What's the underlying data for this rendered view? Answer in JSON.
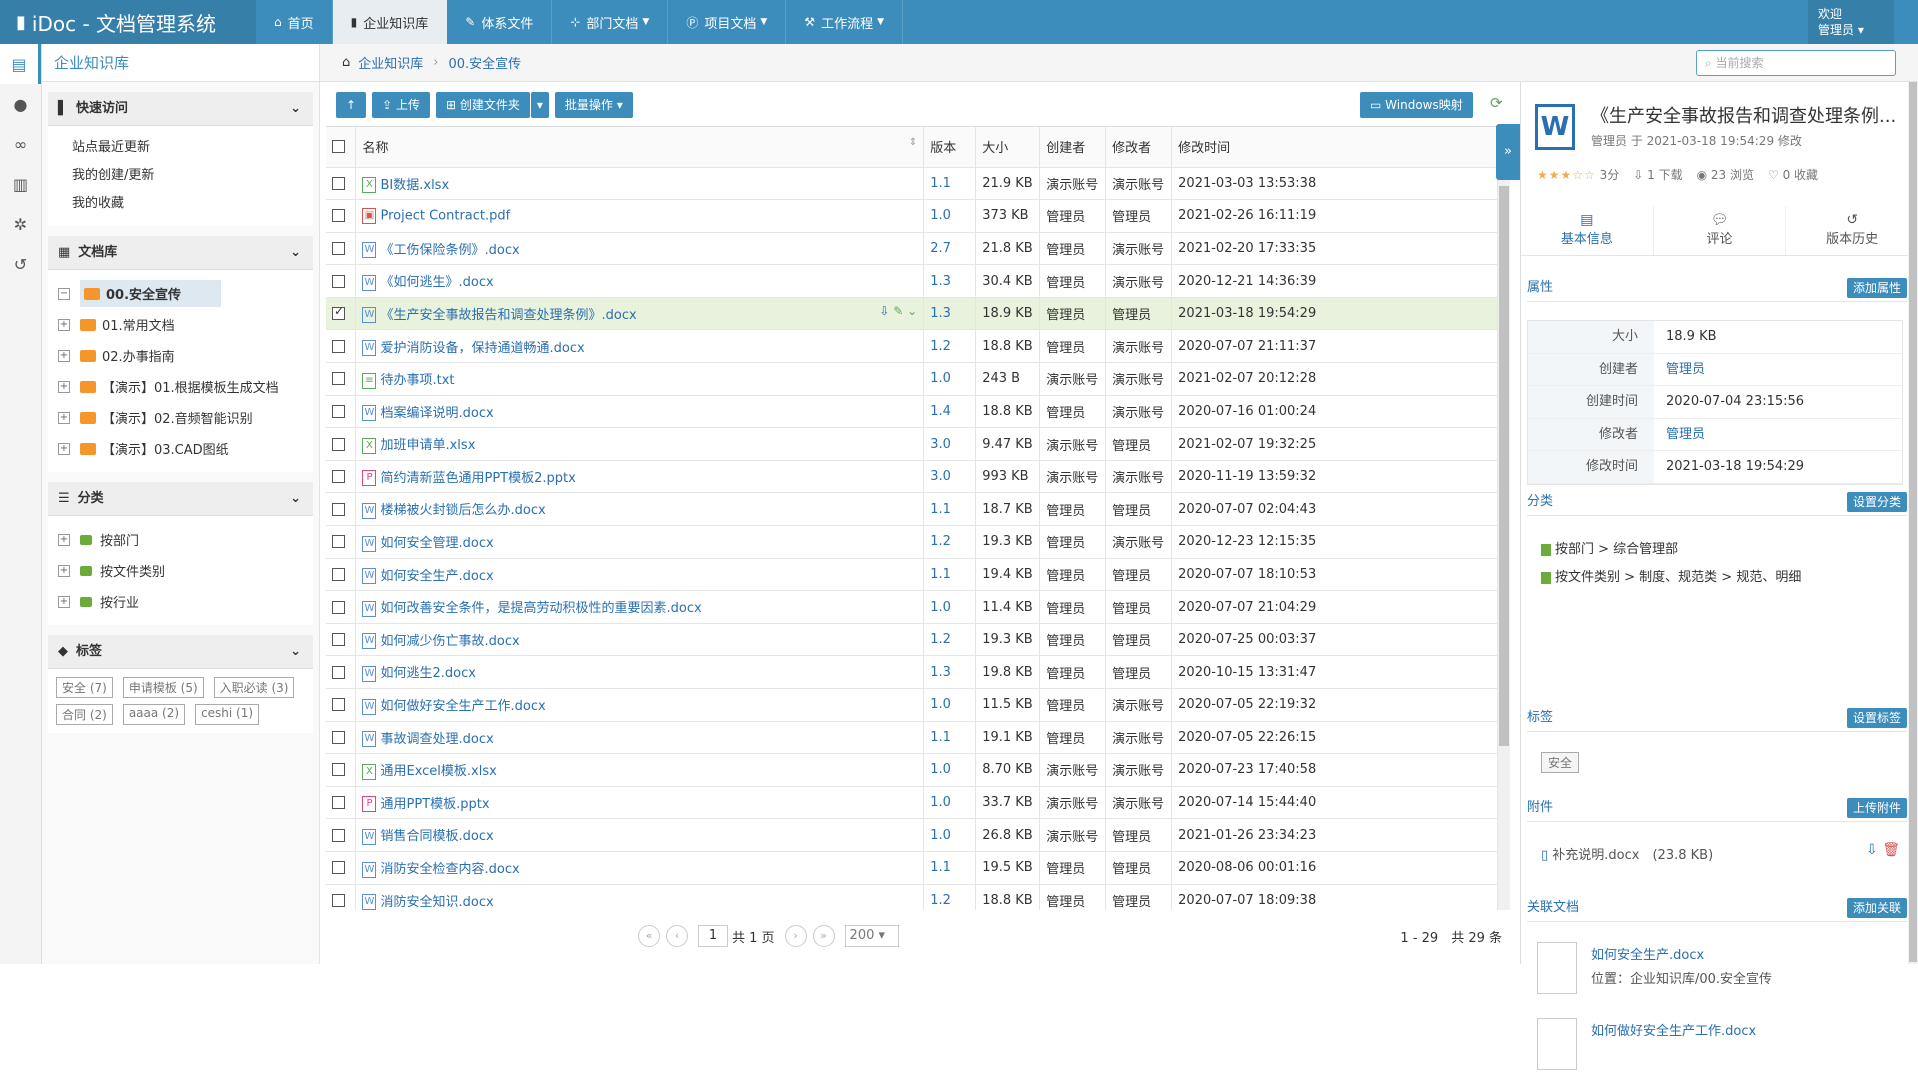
{
  "app": {
    "brand": "iDoc - 文档管理系统"
  },
  "nav": [
    {
      "icon": "home-icon",
      "label": "首页",
      "caret": false,
      "active": false
    },
    {
      "icon": "book-icon",
      "label": "企业知识库",
      "caret": false,
      "active": true
    },
    {
      "icon": "pencil-icon",
      "label": "体系文件",
      "caret": false,
      "active": false
    },
    {
      "icon": "org-icon",
      "label": "部门文档",
      "caret": true,
      "active": false
    },
    {
      "icon": "project-icon",
      "label": "项目文档",
      "caret": true,
      "active": false
    },
    {
      "icon": "workflow-icon",
      "label": "工作流程",
      "caret": true,
      "active": false
    }
  ],
  "user": {
    "welcome": "欢迎",
    "name": "管理员"
  },
  "sidebar": {
    "title": "企业知识库",
    "quick_access": {
      "heading": "快速访问",
      "items": [
        "站点最近更新",
        "我的创建/更新",
        "我的收藏"
      ]
    },
    "library": {
      "heading": "文档库",
      "selected": "00.安全宣传",
      "items": [
        "01.常用文档",
        "02.办事指南",
        "【演示】01.根据模板生成文档",
        "【演示】02.音频智能识别",
        "【演示】03.CAD图纸"
      ]
    },
    "categories": {
      "heading": "分类",
      "items": [
        "按部门",
        "按文件类别",
        "按行业"
      ]
    },
    "tags": {
      "heading": "标签",
      "items": [
        "安全 (7)",
        "申请模板 (5)",
        "入职必读 (3)",
        "合同 (2)",
        "aaaa (2)",
        "ceshi (1)"
      ]
    }
  },
  "breadcrumb": {
    "root": "企业知识库",
    "current": "00.安全宣传"
  },
  "search": {
    "placeholder": "当前搜索"
  },
  "toolbar": {
    "up_label": "↑",
    "upload_label": "上传",
    "create_folder_label": "创建文件夹",
    "batch_label": "批量操作",
    "windows_map_label": "Windows映射"
  },
  "table": {
    "headers": [
      "名称",
      "版本",
      "大小",
      "创建者",
      "修改者",
      "修改时间"
    ],
    "rows": [
      {
        "type": "x",
        "name": "BI数据.xlsx",
        "ver": "1.1",
        "size": "21.9 KB",
        "creator": "演示账号",
        "modifier": "演示账号",
        "time": "2021-03-03 13:53:38",
        "checked": false
      },
      {
        "type": "p",
        "name": "Project Contract.pdf",
        "ver": "1.0",
        "size": "373 KB",
        "creator": "管理员",
        "modifier": "管理员",
        "time": "2021-02-26 16:11:19",
        "checked": false
      },
      {
        "type": "w",
        "name": "《工伤保险条例》.docx",
        "ver": "2.7",
        "size": "21.8 KB",
        "creator": "管理员",
        "modifier": "演示账号",
        "time": "2021-02-20 17:33:35",
        "checked": false
      },
      {
        "type": "w",
        "name": "《如何逃生》.docx",
        "ver": "1.3",
        "size": "30.4 KB",
        "creator": "管理员",
        "modifier": "演示账号",
        "time": "2020-12-21 14:36:39",
        "checked": false
      },
      {
        "type": "w",
        "name": "《生产安全事故报告和调查处理条例》.docx",
        "ver": "1.3",
        "size": "18.9 KB",
        "creator": "管理员",
        "modifier": "管理员",
        "time": "2021-03-18 19:54:29",
        "checked": true
      },
      {
        "type": "w",
        "name": "爱护消防设备，保持通道畅通.docx",
        "ver": "1.2",
        "size": "18.8 KB",
        "creator": "管理员",
        "modifier": "演示账号",
        "time": "2020-07-07 21:11:37",
        "checked": false
      },
      {
        "type": "t",
        "name": "待办事项.txt",
        "ver": "1.0",
        "size": "243 B",
        "creator": "演示账号",
        "modifier": "演示账号",
        "time": "2021-02-07 20:12:28",
        "checked": false
      },
      {
        "type": "w",
        "name": "档案编译说明.docx",
        "ver": "1.4",
        "size": "18.8 KB",
        "creator": "管理员",
        "modifier": "演示账号",
        "time": "2020-07-16 01:00:24",
        "checked": false
      },
      {
        "type": "x",
        "name": "加班申请单.xlsx",
        "ver": "3.0",
        "size": "9.47 KB",
        "creator": "演示账号",
        "modifier": "管理员",
        "time": "2021-02-07 19:32:25",
        "checked": false
      },
      {
        "type": "pp",
        "name": "简约清新蓝色通用PPT模板2.pptx",
        "ver": "3.0",
        "size": "993 KB",
        "creator": "演示账号",
        "modifier": "演示账号",
        "time": "2020-11-19 13:59:32",
        "checked": false
      },
      {
        "type": "w",
        "name": "楼梯被火封锁后怎么办.docx",
        "ver": "1.1",
        "size": "18.7 KB",
        "creator": "管理员",
        "modifier": "管理员",
        "time": "2020-07-07 02:04:43",
        "checked": false
      },
      {
        "type": "w",
        "name": "如何安全管理.docx",
        "ver": "1.2",
        "size": "19.3 KB",
        "creator": "管理员",
        "modifier": "演示账号",
        "time": "2020-12-23 12:15:35",
        "checked": false
      },
      {
        "type": "w",
        "name": "如何安全生产.docx",
        "ver": "1.1",
        "size": "19.4 KB",
        "creator": "管理员",
        "modifier": "管理员",
        "time": "2020-07-07 18:10:53",
        "checked": false
      },
      {
        "type": "w",
        "name": "如何改善安全条件，是提高劳动积极性的重要因素.docx",
        "ver": "1.0",
        "size": "11.4 KB",
        "creator": "管理员",
        "modifier": "管理员",
        "time": "2020-07-07 21:04:29",
        "checked": false
      },
      {
        "type": "w",
        "name": "如何减少伤亡事故.docx",
        "ver": "1.2",
        "size": "19.3 KB",
        "creator": "管理员",
        "modifier": "管理员",
        "time": "2020-07-25 00:03:37",
        "checked": false
      },
      {
        "type": "w",
        "name": "如何逃生2.docx",
        "ver": "1.3",
        "size": "19.8 KB",
        "creator": "管理员",
        "modifier": "管理员",
        "time": "2020-10-15 13:31:47",
        "checked": false
      },
      {
        "type": "w",
        "name": "如何做好安全生产工作.docx",
        "ver": "1.0",
        "size": "11.5 KB",
        "creator": "管理员",
        "modifier": "演示账号",
        "time": "2020-07-05 22:19:32",
        "checked": false
      },
      {
        "type": "w",
        "name": "事故调查处理.docx",
        "ver": "1.1",
        "size": "19.1 KB",
        "creator": "管理员",
        "modifier": "演示账号",
        "time": "2020-07-05 22:26:15",
        "checked": false
      },
      {
        "type": "x",
        "name": "通用Excel模板.xlsx",
        "ver": "1.0",
        "size": "8.70 KB",
        "creator": "演示账号",
        "modifier": "演示账号",
        "time": "2020-07-23 17:40:58",
        "checked": false
      },
      {
        "type": "pp",
        "name": "通用PPT模板.pptx",
        "ver": "1.0",
        "size": "33.7 KB",
        "creator": "演示账号",
        "modifier": "演示账号",
        "time": "2020-07-14 15:44:40",
        "checked": false
      },
      {
        "type": "w",
        "name": "销售合同模板.docx",
        "ver": "1.0",
        "size": "26.8 KB",
        "creator": "演示账号",
        "modifier": "管理员",
        "time": "2021-01-26 23:34:23",
        "checked": false
      },
      {
        "type": "w",
        "name": "消防安全检查内容.docx",
        "ver": "1.1",
        "size": "19.5 KB",
        "creator": "管理员",
        "modifier": "管理员",
        "time": "2020-08-06 00:01:16",
        "checked": false
      },
      {
        "type": "w",
        "name": "消防安全知识.docx",
        "ver": "1.2",
        "size": "18.8 KB",
        "creator": "管理员",
        "modifier": "管理员",
        "time": "2020-07-07 18:09:38",
        "checked": false
      }
    ]
  },
  "pager": {
    "page": "1",
    "total_pages": "共 1 页",
    "page_size": "200",
    "summary": "1 - 29　共 29 条"
  },
  "detail": {
    "title": "《生产安全事故报告和调查处理条例...",
    "subtitle": "管理员 于 2021-03-18 19:54:29 修改",
    "rating": 3,
    "rating_text": "3分",
    "downloads": "1 下载",
    "views": "23 浏览",
    "favorites": "0 收藏",
    "tabs": [
      "基本信息",
      "评论",
      "版本历史"
    ],
    "props_heading": "属性",
    "add_prop_label": "添加属性",
    "props": [
      {
        "k": "大小",
        "v": "18.9 KB",
        "link": false
      },
      {
        "k": "创建者",
        "v": "管理员",
        "link": true
      },
      {
        "k": "创建时间",
        "v": "2020-07-04 23:15:56",
        "link": false
      },
      {
        "k": "修改者",
        "v": "管理员",
        "link": true
      },
      {
        "k": "修改时间",
        "v": "2021-03-18 19:54:29",
        "link": false
      }
    ],
    "category_heading": "分类",
    "set_category_label": "设置分类",
    "categories": [
      "按部门 > 综合管理部",
      "按文件类别 > 制度、规范类 > 规范、明细"
    ],
    "tag_heading": "标签",
    "set_tag_label": "设置标签",
    "tag": "安全",
    "attach_heading": "附件",
    "upload_attach_label": "上传附件",
    "attachment": "补充说明.docx　(23.8 KB)",
    "related_heading": "关联文档",
    "add_related_label": "添加关联",
    "related": [
      {
        "name": "如何安全生产.docx",
        "path": "位置：企业知识库/00.安全宣传"
      },
      {
        "name": "如何做好安全生产工作.docx",
        "path": ""
      }
    ]
  }
}
